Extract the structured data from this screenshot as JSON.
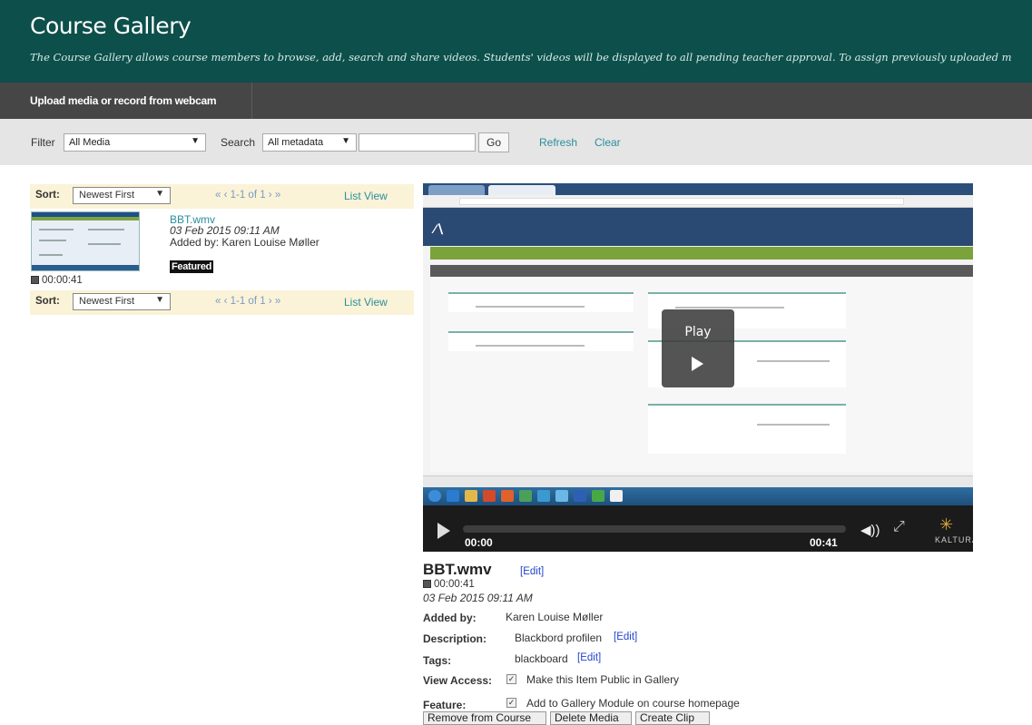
{
  "header": {
    "title": "Course Gallery",
    "subtitle": "The Course Gallery allows course members to browse, add, search and share videos. Students' videos will be displayed to all pending teacher approval.  To assign previously uploaded m"
  },
  "upload": {
    "label": "Upload media or record from webcam"
  },
  "filter": {
    "filter_label": "Filter",
    "filter_value": "All Media",
    "search_label": "Search",
    "search_scope": "All metadata",
    "search_value": "",
    "go_label": "Go",
    "refresh_label": "Refresh",
    "clear_label": "Clear"
  },
  "sort": {
    "label": "Sort:",
    "value": "Newest First",
    "pager": "«  ‹  1-1 of 1  ›  »",
    "list_view": "List View"
  },
  "media_item": {
    "name": "BBT.wmv",
    "date": "03 Feb 2015 09:11 AM",
    "added_by": "Added by: Karen Louise Møller",
    "badge": "Featured",
    "duration": "00:00:41"
  },
  "player": {
    "play_label": "Play",
    "current_time": "00:00",
    "total_time": "00:41",
    "brand": "KALTURA",
    "progress": 0
  },
  "details": {
    "title": "BBT.wmv",
    "edit_label": "[Edit]",
    "duration": "00:00:41",
    "date": "03 Feb 2015 09:11 AM",
    "added_by_label": "Added by:",
    "added_by_value": "Karen Louise Møller",
    "description_label": "Description:",
    "description_value": "Blackbord profilen",
    "tags_label": "Tags:",
    "tags_value": "blackboard",
    "view_access_label": "View Access:",
    "view_access_value": "Make this Item Public in Gallery",
    "view_access_checked": true,
    "feature_label": "Feature:",
    "feature_value": "Add to Gallery Module on course homepage",
    "feature_checked": true
  },
  "actions": {
    "remove": "Remove from Course",
    "delete": "Delete Media",
    "clip": "Create Clip"
  },
  "colors": {
    "header_bg": "#0d4f4b",
    "upload_bar_bg": "#464646",
    "filter_bar_bg": "#e5e5e5",
    "sort_bar_bg": "#fbf3d7",
    "link_teal": "#2a8e9e",
    "link_blue": "#2244cc"
  }
}
